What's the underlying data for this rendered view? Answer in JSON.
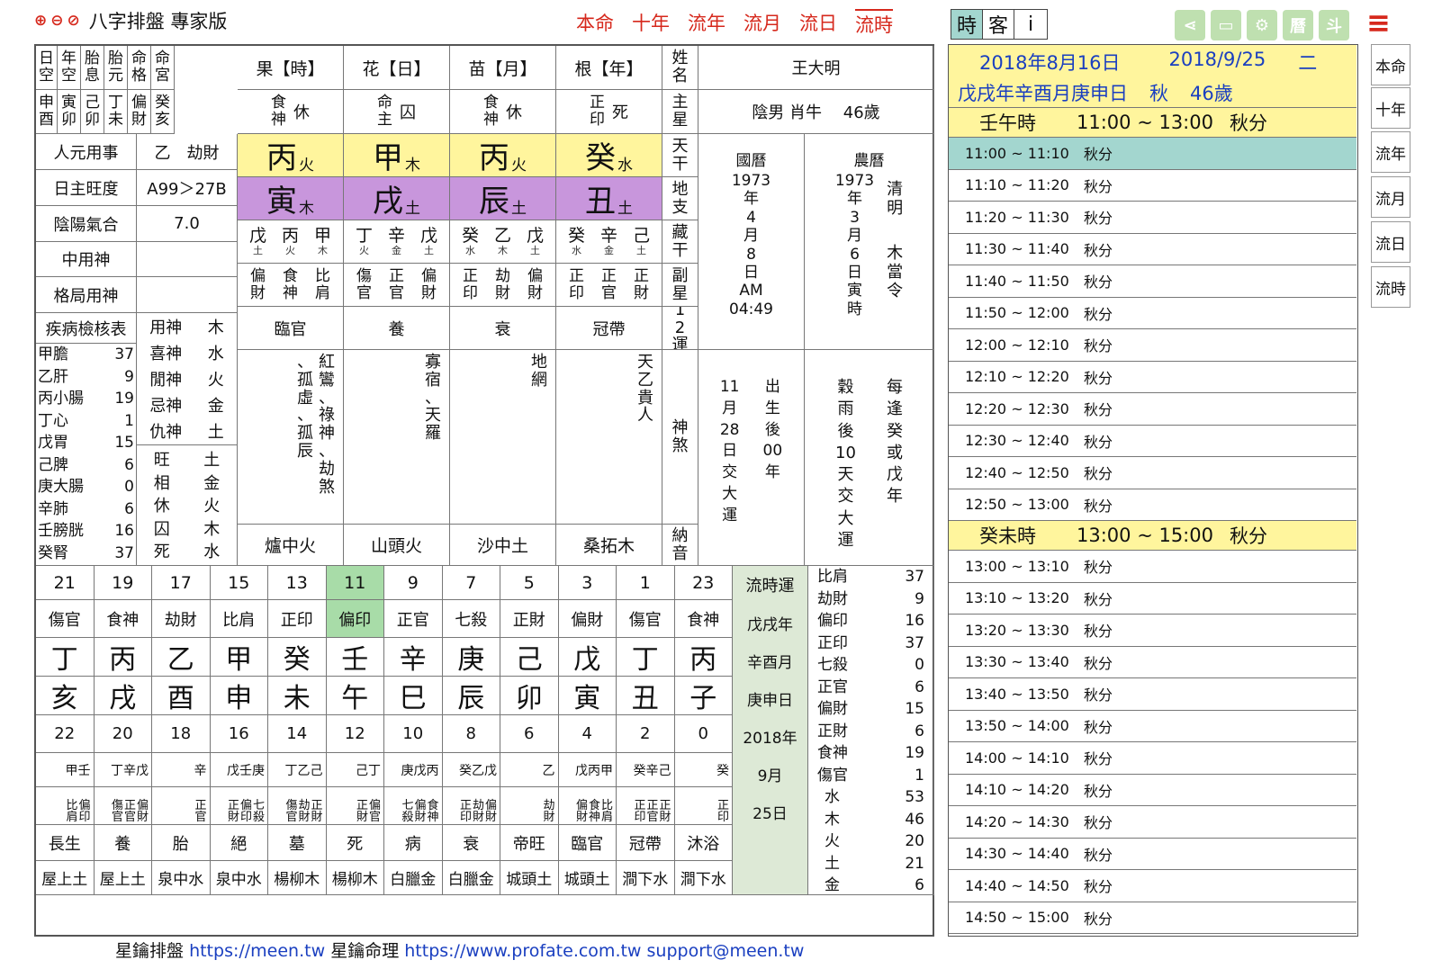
{
  "app": {
    "title": "八字排盤 專家版"
  },
  "toolbar": {
    "zoom_in": "🔍+",
    "zoom_out": "🔍−",
    "zoom_reset": "🔍"
  },
  "top_nav": [
    {
      "label": "本命"
    },
    {
      "label": "十年"
    },
    {
      "label": "流年"
    },
    {
      "label": "流月"
    },
    {
      "label": "流日"
    },
    {
      "label": "流時",
      "active": true
    }
  ],
  "mode_tabs": [
    {
      "label": "時",
      "active": true
    },
    {
      "label": "客"
    },
    {
      "label": "i"
    }
  ],
  "icons": [
    "share-icon",
    "print-icon",
    "gear-icon",
    "calendar-icon",
    "dipper-icon",
    "menu-icon"
  ],
  "icon_glyphs": [
    "⋖",
    "▭",
    "⚙",
    "曆",
    "斗",
    "≡"
  ],
  "header_cols": [
    "日空",
    "年空",
    "胎息",
    "胎元",
    "命格",
    "命宮"
  ],
  "header_vals": [
    "申酉",
    "寅卯",
    "己卯",
    "丁未",
    "偏財",
    "癸亥"
  ],
  "pillar_titles": [
    "果【時】",
    "花【日】",
    "苗【月】",
    "根【年】"
  ],
  "pillar_master": [
    {
      "a": "食神",
      "b": "休"
    },
    {
      "a": "命主",
      "b": "囚"
    },
    {
      "a": "食神",
      "b": "休"
    },
    {
      "a": "正印",
      "b": "死"
    }
  ],
  "label_name": "姓名",
  "label_main": "主星",
  "label_stem": "天干",
  "label_branch": "地支",
  "label_hidden": "藏干",
  "label_sub": "副星",
  "label_12": "12運",
  "label_shensha": "神煞",
  "label_nayin": "納音",
  "person": {
    "name": "王大明",
    "info": "陰男 肖牛　 46歲"
  },
  "left_rows": [
    {
      "k": "人元用事",
      "v": "乙　劫財"
    },
    {
      "k": "日主旺度",
      "v": "A99＞27B"
    },
    {
      "k": "陰陽氣合",
      "v": "7.0"
    },
    {
      "k": "中用神",
      "v": ""
    },
    {
      "k": "格局用神",
      "v": ""
    }
  ],
  "stems": [
    {
      "ch": "丙",
      "el": "火"
    },
    {
      "ch": "甲",
      "el": "木"
    },
    {
      "ch": "丙",
      "el": "火"
    },
    {
      "ch": "癸",
      "el": "水"
    }
  ],
  "branches": [
    {
      "ch": "寅",
      "el": "木"
    },
    {
      "ch": "戌",
      "el": "土"
    },
    {
      "ch": "辰",
      "el": "土"
    },
    {
      "ch": "丑",
      "el": "土"
    }
  ],
  "hidden": [
    [
      {
        "c": "戊",
        "e": "土"
      },
      {
        "c": "丙",
        "e": "火"
      },
      {
        "c": "甲",
        "e": "木"
      }
    ],
    [
      {
        "c": "丁",
        "e": "火"
      },
      {
        "c": "辛",
        "e": "金"
      },
      {
        "c": "戊",
        "e": "土"
      }
    ],
    [
      {
        "c": "癸",
        "e": "水"
      },
      {
        "c": "乙",
        "e": "木"
      },
      {
        "c": "戊",
        "e": "土"
      }
    ],
    [
      {
        "c": "癸",
        "e": "水"
      },
      {
        "c": "辛",
        "e": "金"
      },
      {
        "c": "己",
        "e": "土"
      }
    ]
  ],
  "sub_stars": [
    [
      "偏財",
      "食神",
      "比肩"
    ],
    [
      "傷官",
      "正官",
      "偏財"
    ],
    [
      "正印",
      "劫財",
      "偏財"
    ],
    [
      "正印",
      "正官",
      "正財"
    ]
  ],
  "twelve": [
    "臨官",
    "養",
    "衰",
    "冠帶"
  ],
  "shensha": [
    [
      "紅鸞、祿神、劫煞",
      "、孤虛、孤辰"
    ],
    [
      "寡宿、天羅"
    ],
    [
      "地網"
    ],
    [
      "天乙貴人"
    ]
  ],
  "nayin": [
    "爐中火",
    "山頭火",
    "沙中土",
    "桑拓木"
  ],
  "calendar": {
    "solar_label": "國曆",
    "solar": [
      "1973",
      "年",
      "4",
      "月",
      "8",
      "日",
      "AM",
      "04:49"
    ],
    "lunar_label": "農曆",
    "lunar": [
      "1973",
      "年",
      "3",
      "月",
      "6",
      "日",
      "寅",
      "時"
    ],
    "lunar_side": [
      "清",
      "明",
      "",
      "木",
      "當",
      "令"
    ],
    "start1": [
      "11",
      "月",
      "28",
      "日",
      "交",
      "大",
      "運"
    ],
    "start2": [
      "出",
      "生",
      "後",
      "00",
      "年"
    ],
    "start3": [
      "穀",
      "雨",
      "後",
      "10",
      "天",
      "交",
      "大",
      "運"
    ],
    "start4": [
      "每",
      "逢",
      "癸",
      "或",
      "戊",
      "年"
    ]
  },
  "disease": {
    "title": "疾病檢核表",
    "items": [
      {
        "k": "甲膽",
        "v": "37"
      },
      {
        "k": "乙肝",
        "v": "9"
      },
      {
        "k": "丙小腸",
        "v": "19"
      },
      {
        "k": "丁心",
        "v": "1"
      },
      {
        "k": "戊胃",
        "v": "15"
      },
      {
        "k": "己脾",
        "v": "6"
      },
      {
        "k": "庚大腸",
        "v": "0"
      },
      {
        "k": "辛肺",
        "v": "6"
      },
      {
        "k": "壬膀胱",
        "v": "16"
      },
      {
        "k": "癸腎",
        "v": "37"
      }
    ]
  },
  "gods": [
    {
      "k": "用神",
      "v": "木"
    },
    {
      "k": "喜神",
      "v": "水"
    },
    {
      "k": "閒神",
      "v": "火"
    },
    {
      "k": "忌神",
      "v": "金"
    },
    {
      "k": "仇神",
      "v": "土"
    }
  ],
  "seasons": [
    {
      "k": "旺",
      "v": "土"
    },
    {
      "k": "相",
      "v": "金"
    },
    {
      "k": "休",
      "v": "火"
    },
    {
      "k": "囚",
      "v": "木"
    },
    {
      "k": "死",
      "v": "水"
    }
  ],
  "luck": {
    "hours": [
      "21",
      "19",
      "17",
      "15",
      "13",
      "11",
      "9",
      "7",
      "5",
      "3",
      "1",
      "23"
    ],
    "gods": [
      "傷官",
      "食神",
      "劫財",
      "比肩",
      "正印",
      "偏印",
      "正官",
      "七殺",
      "正財",
      "偏財",
      "傷官",
      "食神"
    ],
    "stems": [
      "丁",
      "丙",
      "乙",
      "甲",
      "癸",
      "壬",
      "辛",
      "庚",
      "己",
      "戊",
      "丁",
      "丙"
    ],
    "branches": [
      "亥",
      "戌",
      "酉",
      "申",
      "未",
      "午",
      "巳",
      "辰",
      "卯",
      "寅",
      "丑",
      "子"
    ],
    "ends": [
      "22",
      "20",
      "18",
      "16",
      "14",
      "12",
      "10",
      "8",
      "6",
      "4",
      "2",
      "0"
    ],
    "hidden": [
      "甲壬",
      "丁辛戊",
      "辛",
      "戊壬庚",
      "丁乙己",
      "己丁",
      "庚戊丙",
      "癸乙戊",
      "乙",
      "戊丙甲",
      "癸辛己",
      "癸"
    ],
    "subs": [
      "比偏肩印",
      "傷正偏官官財",
      "正官",
      "正偏七財印殺",
      "傷劫正官財財",
      "正偏財官",
      "七偏食殺財神",
      "正劫偏印財財",
      "劫財",
      "偏食比財神肩",
      "正正正印官財",
      "正印"
    ],
    "twelve": [
      "長生",
      "養",
      "胎",
      "絕",
      "墓",
      "死",
      "病",
      "衰",
      "帝旺",
      "臨官",
      "冠帶",
      "沐浴"
    ],
    "nayin": [
      "屋上土",
      "屋上土",
      "泉中水",
      "泉中水",
      "楊柳木",
      "楊柳木",
      "白臘金",
      "白臘金",
      "城頭土",
      "城頭土",
      "澗下水",
      "澗下水"
    ],
    "active_index": 5
  },
  "flow_col": {
    "title": "流時運",
    "items": [
      "戊戌年",
      "辛酉月",
      "庚申日",
      "2018年",
      "9月",
      "25日"
    ]
  },
  "stats": [
    {
      "k": "比肩",
      "v": "37"
    },
    {
      "k": "劫財",
      "v": "9"
    },
    {
      "k": "偏印",
      "v": "16"
    },
    {
      "k": "正印",
      "v": "37"
    },
    {
      "k": "七殺",
      "v": "0"
    },
    {
      "k": "正官",
      "v": "6"
    },
    {
      "k": "偏財",
      "v": "15"
    },
    {
      "k": "正財",
      "v": "6"
    },
    {
      "k": "食神",
      "v": "19"
    },
    {
      "k": "傷官",
      "v": "1"
    }
  ],
  "elements": [
    {
      "k": "水",
      "v": "53"
    },
    {
      "k": "木",
      "v": "46"
    },
    {
      "k": "火",
      "v": "20"
    },
    {
      "k": "土",
      "v": "21"
    },
    {
      "k": "金",
      "v": "6"
    }
  ],
  "footer": {
    "a": "星鑰排盤",
    "a_url": "https://meen.tw",
    "b": "星鑰命理",
    "b_url": "https://www.profate.com.tw",
    "email": "support@meen.tw"
  },
  "right": {
    "date1": "2018年8月16日",
    "date2": "2018/9/25",
    "weekday": "二",
    "line2a": "戊戌年辛酉月庚申日",
    "line2b": "秋",
    "line2c": "46歲",
    "block1": {
      "title": "壬午時",
      "range": "11:00 ~ 13:00",
      "term": "秋分",
      "rows": [
        "11:00 ~ 11:10",
        "11:10 ~ 11:20",
        "11:20 ~ 11:30",
        "11:30 ~ 11:40",
        "11:40 ~ 11:50",
        "11:50 ~ 12:00",
        "12:00 ~ 12:10",
        "12:10 ~ 12:20",
        "12:20 ~ 12:30",
        "12:30 ~ 12:40",
        "12:40 ~ 12:50",
        "12:50 ~ 13:00"
      ]
    },
    "block2": {
      "title": "癸未時",
      "range": "13:00 ~ 15:00",
      "term": "秋分",
      "rows": [
        "13:00 ~ 13:10",
        "13:10 ~ 13:20",
        "13:20 ~ 13:30",
        "13:30 ~ 13:40",
        "13:40 ~ 13:50",
        "13:50 ~ 14:00",
        "14:00 ~ 14:10",
        "14:10 ~ 14:20",
        "14:20 ~ 14:30",
        "14:30 ~ 14:40",
        "14:40 ~ 14:50",
        "14:50 ~ 15:00"
      ]
    },
    "row_term": "秋分"
  },
  "side_tabs": [
    {
      "label": "本命"
    },
    {
      "label": "十年"
    },
    {
      "label": "流年"
    },
    {
      "label": "流月"
    },
    {
      "label": "流日"
    },
    {
      "label": "流時",
      "active": true
    }
  ]
}
